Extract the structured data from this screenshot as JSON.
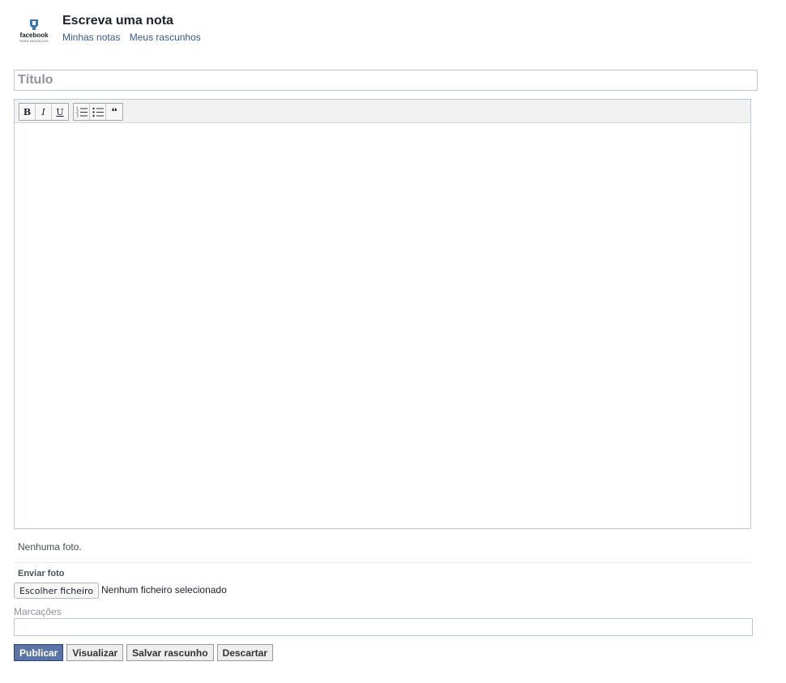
{
  "header": {
    "logo_word": "facebook",
    "logo_sub": "PARA NEGÓCIOS",
    "title": "Escreva uma nota",
    "links": [
      "Minhas notas",
      "Meus rascunhos"
    ]
  },
  "editor": {
    "title_placeholder": "Título",
    "toolbar": {
      "bold": "B",
      "italic": "I",
      "underline": "U",
      "quote": "❛❛"
    }
  },
  "photos": {
    "none_text": "Nenhuma foto.",
    "upload_label": "Enviar foto",
    "choose_file_label": "Escolher ficheiro",
    "file_status": "Nenhum ficheiro selecionado"
  },
  "tags": {
    "label": "Marcações",
    "value": ""
  },
  "actions": {
    "publish": "Publicar",
    "preview": "Visualizar",
    "save_draft": "Salvar rascunho",
    "discard": "Descartar"
  },
  "colors": {
    "link": "#365899",
    "primary_button": "#5b74a8",
    "input_border": "#bdc7d8"
  }
}
